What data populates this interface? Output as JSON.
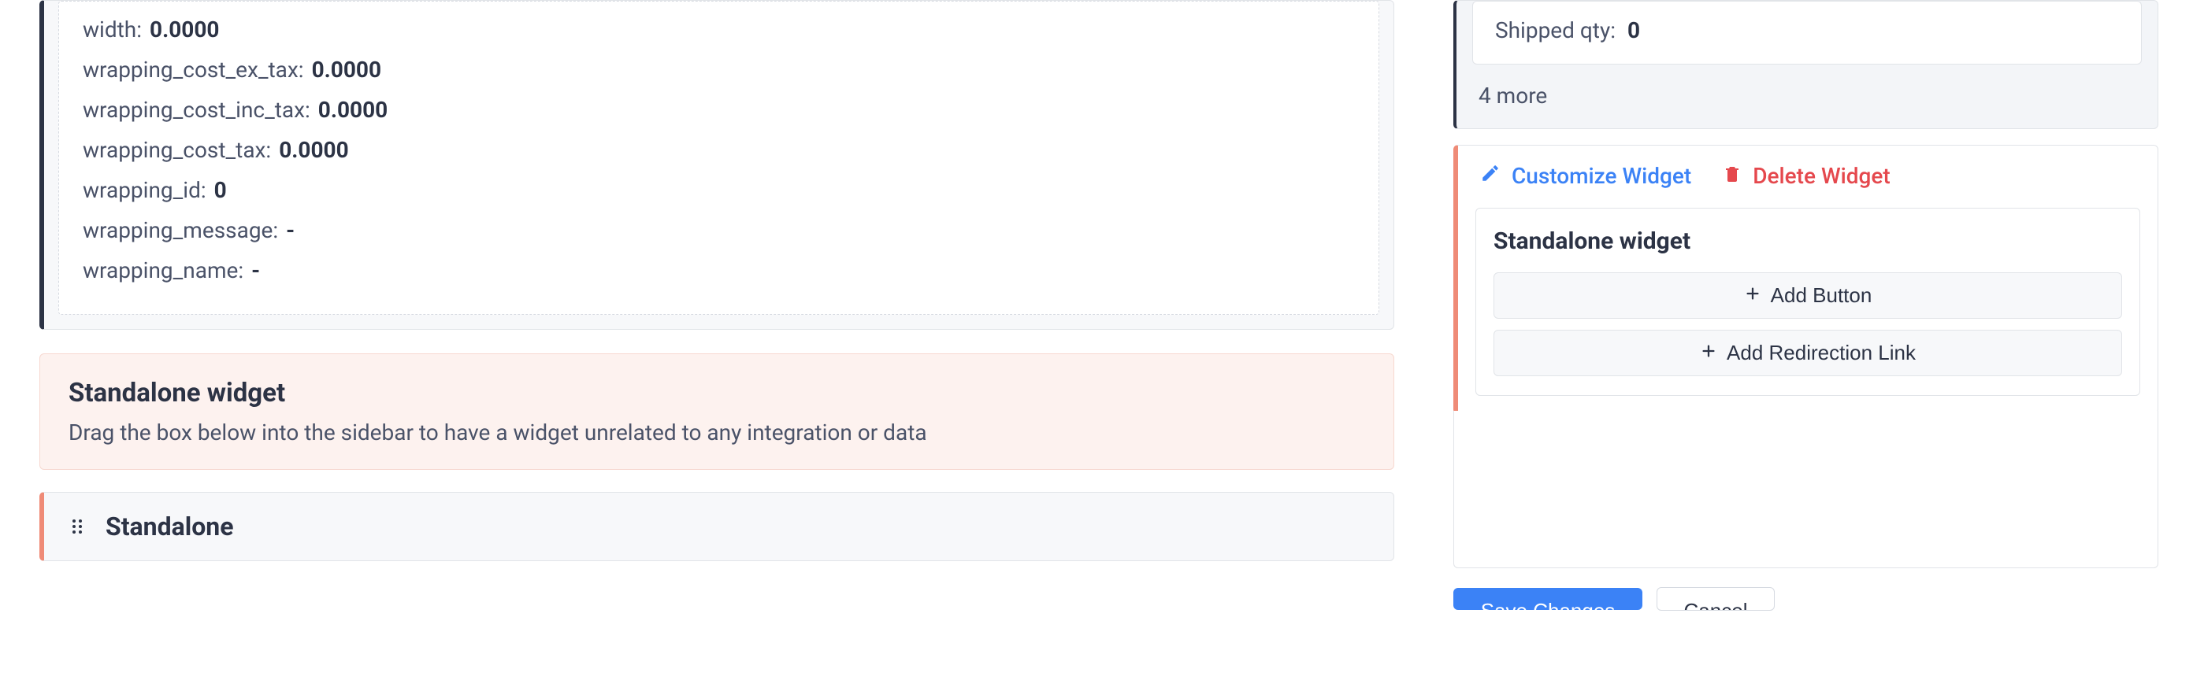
{
  "details": {
    "rows": [
      {
        "key": "width:",
        "value": "0.0000"
      },
      {
        "key": "wrapping_cost_ex_tax:",
        "value": "0.0000"
      },
      {
        "key": "wrapping_cost_inc_tax:",
        "value": "0.0000"
      },
      {
        "key": "wrapping_cost_tax:",
        "value": "0.0000"
      },
      {
        "key": "wrapping_id:",
        "value": "0"
      },
      {
        "key": "wrapping_message:",
        "value": "-"
      },
      {
        "key": "wrapping_name:",
        "value": "-"
      }
    ]
  },
  "tip": {
    "title": "Standalone widget",
    "desc": "Drag the box below into the sidebar to have a widget unrelated to any integration or data"
  },
  "standalone_block": {
    "label": "Standalone"
  },
  "right": {
    "shipped": {
      "label": "Shipped qty:",
      "value": "0"
    },
    "more": "4 more",
    "customize": "Customize Widget",
    "delete": "Delete Widget",
    "widget_title": "Standalone widget",
    "add_button": "Add Button",
    "add_redirect": "Add Redirection Link",
    "save": "Save Changes",
    "cancel": "Cancel"
  }
}
